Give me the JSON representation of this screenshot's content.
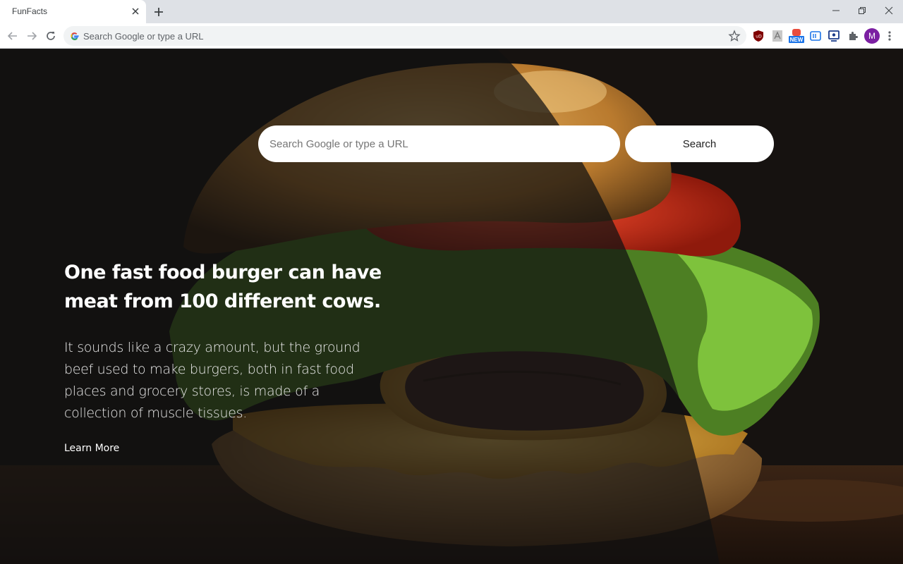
{
  "browser": {
    "tab_title": "FunFacts",
    "omnibox_placeholder": "Search Google or type a URL",
    "extension_badge_new": "NEW",
    "profile_initial": "M",
    "extension_icons": [
      "ublock-icon",
      "pdf-icon",
      "new-extension-icon",
      "reader-icon",
      "monitor-icon",
      "puzzle-icon"
    ]
  },
  "search": {
    "placeholder": "Search Google or type a URL",
    "button_label": "Search"
  },
  "fact": {
    "title": "One fast food burger can have meat from 100 different cows.",
    "body": "It sounds like a crazy amount, but the ground beef used to make burgers, both in fast food places and grocery stores, is made of a collection of muscle tissues.",
    "link_label": "Learn More"
  },
  "colors": {
    "overlay": "#1a1a1a",
    "bun": "#c8893a",
    "lettuce": "#5e9a2a",
    "tomato": "#c9301c",
    "cheese": "#d9a640",
    "patty": "#3a2620"
  }
}
